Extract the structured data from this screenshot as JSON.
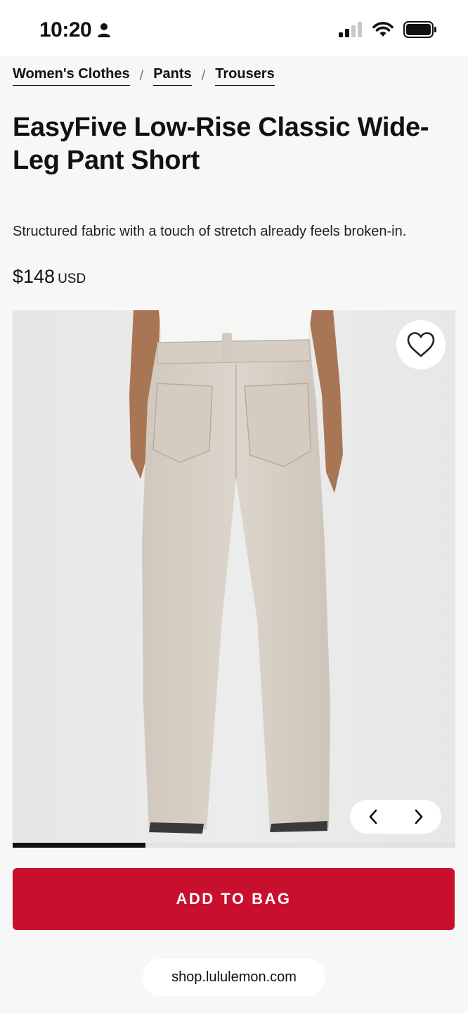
{
  "status_bar": {
    "time": "10:20"
  },
  "breadcrumb": {
    "items": [
      {
        "label": "Women's Clothes"
      },
      {
        "label": "Pants"
      },
      {
        "label": "Trousers"
      }
    ],
    "separator": "/"
  },
  "product": {
    "title": "EasyFive Low-Rise Classic Wide-Leg Pant Short",
    "description": "Structured fabric with a touch of stretch already feels broken-in.",
    "price": "$148",
    "currency": "USD"
  },
  "gallery": {
    "progress_fraction": 0.3
  },
  "actions": {
    "add_to_bag_label": "ADD TO BAG",
    "button_color": "#c8102e"
  },
  "browser": {
    "url": "shop.lululemon.com"
  }
}
